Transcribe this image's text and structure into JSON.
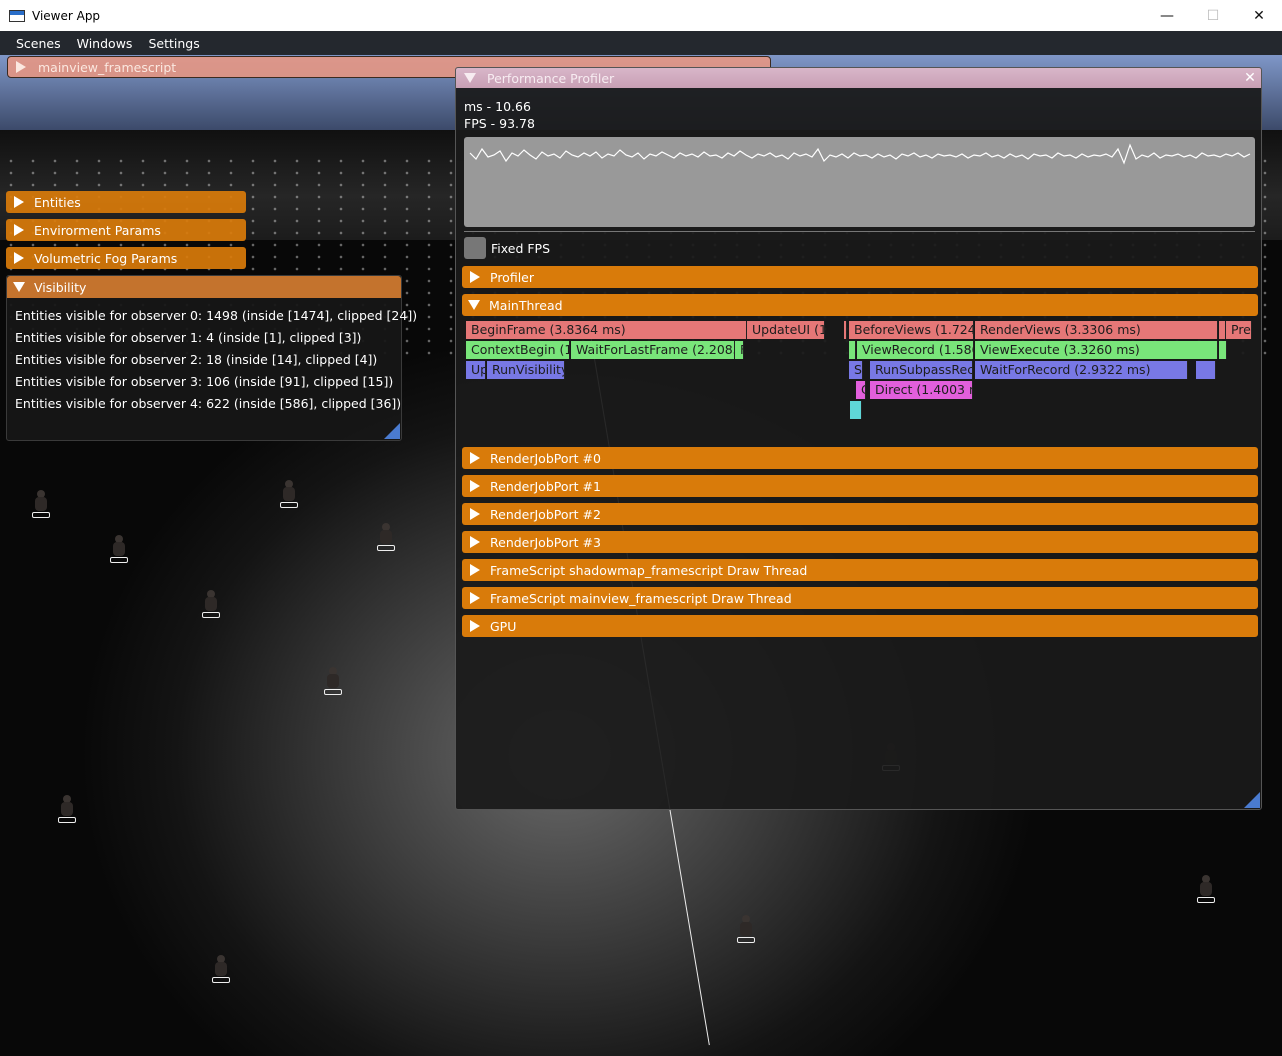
{
  "window": {
    "title": "Viewer App",
    "controls": [
      "—",
      "☐",
      "✕"
    ]
  },
  "menu": [
    "Scenes",
    "Windows",
    "Settings"
  ],
  "mainview_header": "mainview_framescript",
  "left_headers": [
    "Entities",
    "Envirorment Params",
    "Volumetric Fog Params"
  ],
  "visibility": {
    "title": "Visibility",
    "lines": [
      "Entities visible for observer 0: 1498 (inside [1474], clipped [24])",
      "Entities visible for observer 1: 4 (inside [1], clipped [3])",
      "Entities visible for observer 2: 18 (inside [14], clipped [4])",
      "Entities visible for observer 3: 106 (inside [91], clipped [15])",
      "Entities visible for observer 4: 622 (inside [586], clipped [36])"
    ]
  },
  "profiler": {
    "title": "Performance Profiler",
    "close": "✕",
    "ms": "ms - 10.66",
    "fps": "FPS - 93.78",
    "fixed_fps_label": "Fixed FPS",
    "sections": [
      "Profiler",
      "MainThread"
    ],
    "collapsed_sections": [
      "RenderJobPort #0",
      "RenderJobPort #1",
      "RenderJobPort #2",
      "RenderJobPort #3",
      "FrameScript shadowmap_framescript Draw Thread",
      "FrameScript mainview_framescript Draw Thread",
      "GPU"
    ],
    "timeline": {
      "row0": [
        "BeginFrame (3.8364 ms)",
        "UpdateUI (1.",
        "BeforeViews (1.7240 r",
        "RenderViews (3.3306 ms)",
        "E",
        "Pre"
      ],
      "row1": [
        "ContextBegin (1.3",
        "WaitForLastFrame (2.2083 n",
        "F",
        "ViewRecord (1.5866",
        "ViewExecute (3.3260 ms)"
      ],
      "row2": [
        "Up",
        "RunVisibility",
        "S",
        "RunSubpassReco",
        "WaitForRecord (2.9322 ms)"
      ],
      "row3": [
        "C",
        "Direct (1.4003 ms"
      ]
    }
  },
  "colors": {
    "header_orange": "#d97b0a",
    "timeline_red": "#e57777",
    "timeline_green": "#79e57a",
    "timeline_blue": "#7878e5",
    "timeline_pink": "#e25fdc",
    "graph_bg": "#999999"
  }
}
